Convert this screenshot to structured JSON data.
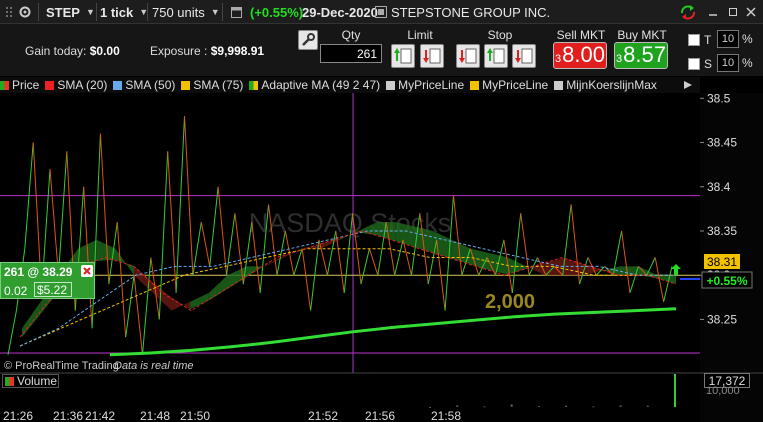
{
  "toolbar": {
    "symbol": "STEP",
    "tick": "1 tick",
    "units": "750 units",
    "change": "(+0.55%)",
    "date": "29-Dec-2020",
    "company": "STEPSTONE GROUP INC."
  },
  "account": {
    "gain_label": "Gain today:",
    "gain_value": "$0.00",
    "exposure_label": "Exposure :",
    "exposure_value": "$9,998.91"
  },
  "order": {
    "qty_label": "Qty",
    "qty_value": "261",
    "limit_label": "Limit",
    "stop_label": "Stop",
    "sell_label": "Sell MKT",
    "sell_small": "3",
    "sell_big": "8.00",
    "buy_label": "Buy MKT",
    "buy_small": "3",
    "buy_big": "8.57",
    "t_label": "T",
    "t_value": "10",
    "s_label": "S",
    "s_value": "10",
    "pct": "%"
  },
  "legend": [
    {
      "label": "Price",
      "color": "#33bb33"
    },
    {
      "label": "SMA (20)",
      "color": "#ee2222"
    },
    {
      "label": "SMA (50)",
      "color": "#66aaee"
    },
    {
      "label": "SMA (75)",
      "color": "#f2c100"
    },
    {
      "label": "Adaptive MA (49 2 47)",
      "color": "#22aa22"
    },
    {
      "label": "MyPriceLine",
      "color": "#cccccc"
    },
    {
      "label": "MyPriceLine",
      "color": "#f2c100"
    },
    {
      "label": "MijnKoerslijnMax",
      "color": "#cccccc"
    }
  ],
  "chart_data": {
    "type": "line",
    "watermark": "NASDAQ Stocks",
    "annotation": "2,000",
    "position_label": "261 @ 38.29",
    "position_pnl_pct": "0.02",
    "position_pnl_value": "$5.22",
    "price_tag": "38.31",
    "change_tag": "+0.55%",
    "credit": "© ProRealTime Trading",
    "credit_note": "Data is real time",
    "y_ticks": [
      "38.5",
      "38.45",
      "38.4",
      "38.35",
      "38.3",
      "38.25"
    ],
    "ylim": [
      38.203,
      38.506
    ],
    "x_ticks": [
      "21:26",
      "21:36",
      "21:42",
      "21:48",
      "21:50",
      "21:52",
      "21:56",
      "21:58"
    ],
    "h_lines": [
      38.39,
      38.3,
      38.212
    ],
    "price": [
      38.21,
      38.26,
      38.33,
      38.45,
      38.28,
      38.42,
      38.3,
      38.44,
      38.26,
      38.4,
      38.24,
      38.46,
      38.29,
      38.36,
      38.23,
      38.3,
      38.21,
      38.32,
      38.25,
      38.44,
      38.28,
      38.48,
      38.3,
      38.36,
      38.31,
      38.4,
      38.3,
      38.37,
      38.29,
      38.36,
      38.28,
      38.38,
      38.3,
      38.35,
      38.3,
      38.33,
      38.26,
      38.34,
      38.3,
      38.35,
      38.28,
      38.37,
      38.29,
      38.33,
      38.3,
      38.36,
      38.3,
      38.34,
      38.3,
      38.37,
      38.29,
      38.34,
      38.26,
      38.39,
      38.3,
      38.33,
      38.3,
      38.32,
      38.3,
      38.34,
      38.28,
      38.37,
      38.3,
      38.32,
      38.3,
      38.31,
      38.3,
      38.38,
      38.29,
      38.32,
      38.3,
      38.31,
      38.3,
      38.35,
      38.28,
      38.31,
      38.3,
      38.32,
      38.27,
      38.31
    ],
    "adaptive_ma": [
      38.24,
      38.27,
      38.3,
      38.33,
      38.34,
      38.33,
      38.3,
      38.28,
      38.26,
      38.27,
      38.28,
      38.3,
      38.31,
      38.31,
      38.32,
      38.33,
      38.33,
      38.34,
      38.35,
      38.36,
      38.36,
      38.355,
      38.35,
      38.34,
      38.33,
      38.325,
      38.32,
      38.31,
      38.3,
      38.3,
      38.3,
      38.305,
      38.31,
      38.31,
      38.3,
      38.3
    ],
    "sma20": [
      38.23,
      38.27,
      38.31,
      38.32,
      38.31,
      38.28,
      38.26,
      38.28,
      38.3,
      38.32,
      38.33,
      38.34,
      38.35,
      38.34,
      38.33,
      38.32,
      38.31,
      38.3,
      38.31,
      38.32,
      38.31,
      38.3,
      38.3,
      38.29
    ],
    "sma50": [
      38.22,
      38.24,
      38.27,
      38.3,
      38.31,
      38.31,
      38.32,
      38.33,
      38.34,
      38.35,
      38.35,
      38.34,
      38.33,
      38.32,
      38.31,
      38.31,
      38.3,
      38.3
    ],
    "sma75": [
      38.22,
      38.24,
      38.26,
      38.28,
      38.3,
      38.31,
      38.32,
      38.33,
      38.33,
      38.33,
      38.32,
      38.32,
      38.31,
      38.31,
      38.3,
      38.3,
      38.3
    ],
    "cumulative_volume_line": [
      38.21,
      38.212,
      38.215,
      38.219,
      38.224,
      38.23,
      38.236,
      38.241,
      38.245,
      38.249,
      38.253,
      38.256,
      38.258,
      38.26,
      38.262
    ],
    "volume_label": "Volume",
    "volume_value": "17,372",
    "volume_tick": "10,000",
    "volume_bars": [
      0.0,
      0.05,
      0.02,
      0.08,
      0.03,
      0.04,
      0.02,
      0.05,
      0.04,
      1.0
    ]
  }
}
